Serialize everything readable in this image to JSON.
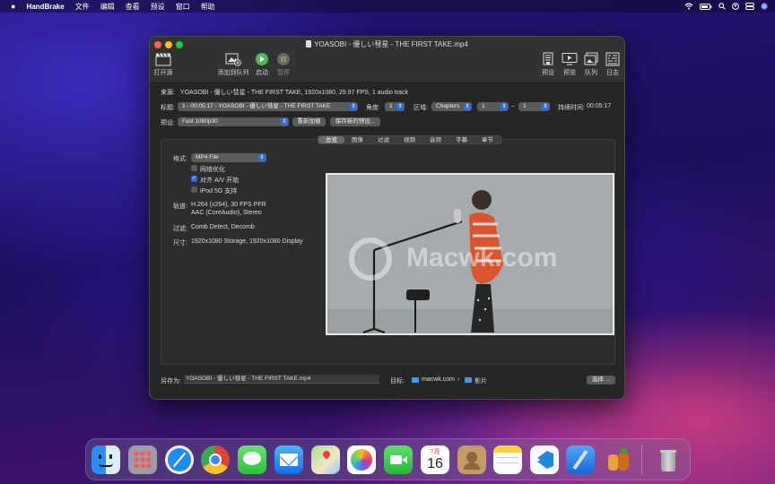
{
  "menubar": {
    "app_name": "HandBrake",
    "items": [
      "文件",
      "编辑",
      "查看",
      "预设",
      "窗口",
      "帮助"
    ]
  },
  "window": {
    "title": "YOASOBI - 優しい彗星 - THE FIRST TAKE.mp4",
    "toolbar": {
      "open_source": "打开源",
      "add_to_queue": "添加到队列",
      "start": "启动",
      "pause": "暂停",
      "presets": "预设",
      "preview": "预览",
      "queue": "队列",
      "log": "日志"
    }
  },
  "source": {
    "label": "来源:",
    "value": "YOASOBI - 優しい彗星 - THE FIRST TAKE, 1920x1080, 29.97 FPS, 1 audio track"
  },
  "title_row": {
    "title_label": "标题:",
    "title_value": "1 - 00:05:17 - YOASOBI - 優しい彗星 - THE FIRST TAKE",
    "angle_label": "角度:",
    "angle_value": "1",
    "range_label": "区域:",
    "range_type": "Chapters",
    "range_start": "1",
    "range_dash": "–",
    "range_end": "1",
    "duration_label": "持续时间:",
    "duration_value": "00:05:17"
  },
  "preset_row": {
    "label": "预设:",
    "value": "Fast 1080p30",
    "reload": "重新加载",
    "save_new": "保存新的预设..."
  },
  "tabs": [
    "总览",
    "图像",
    "过滤",
    "视频",
    "音频",
    "字幕",
    "章节"
  ],
  "summary": {
    "format_label": "格式:",
    "format_value": "MP4 File",
    "web_optimized": "网络优化",
    "align_av": "对齐 A/V 开始",
    "ipod": "iPod 5G 支持",
    "tracks_label": "轨道:",
    "tracks_video": "H.264 (x264), 30 FPS PFR",
    "tracks_audio": "AAC (CoreAudio), Stereo",
    "filters_label": "过滤:",
    "filters_value": "Comb Detect, Decomb",
    "size_label": "尺寸:",
    "size_value": "1920x1080 Storage, 1920x1080 Display"
  },
  "watermark": "Macwk.com",
  "save_row": {
    "save_as_label": "另存为:",
    "save_as_value": "YOASOBI - 優しい彗星 - THE FIRST TAKE.mp4",
    "dest_label": "目标:",
    "dest_path_1": "macwk.com",
    "dest_sep": "›",
    "dest_path_2": "影片",
    "choose": "选择 ..."
  },
  "dock": {
    "calendar_month": "7月",
    "calendar_day": "16"
  }
}
